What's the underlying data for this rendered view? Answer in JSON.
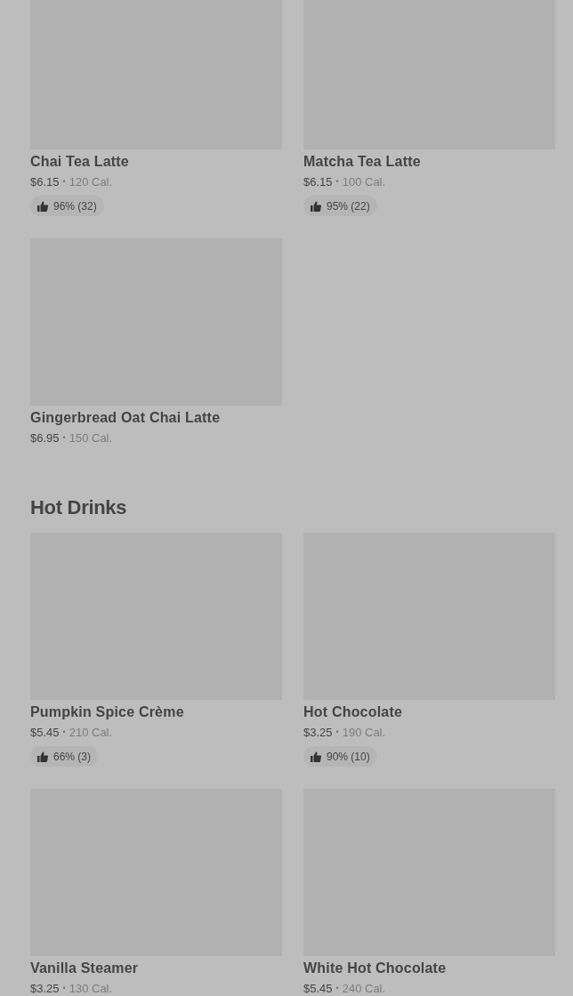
{
  "sections": [
    {
      "items": [
        {
          "name": "Chai Tea Latte",
          "price": "$6.15",
          "separator": "•",
          "calories": "120 Cal.",
          "rating": "96% (32)"
        },
        {
          "name": "Matcha Tea Latte",
          "price": "$6.15",
          "separator": "•",
          "calories": "100 Cal.",
          "rating": "95% (22)"
        },
        {
          "name": "Gingerbread Oat Chai Latte",
          "price": "$6.95",
          "separator": "•",
          "calories": "150 Cal."
        }
      ]
    },
    {
      "title": "Hot Drinks",
      "items": [
        {
          "name": "Pumpkin Spice Crème",
          "price": "$5.45",
          "separator": "•",
          "calories": "210 Cal.",
          "rating": "66% (3)"
        },
        {
          "name": "Hot Chocolate",
          "price": "$3.25",
          "separator": "•",
          "calories": "190 Cal.",
          "rating": "90% (10)"
        },
        {
          "name": "Vanilla Steamer",
          "price": "$3.25",
          "separator": "•",
          "calories": "130 Cal."
        },
        {
          "name": "White Hot Chocolate",
          "price": "$5.45",
          "separator": "•",
          "calories": "240 Cal."
        }
      ]
    }
  ]
}
